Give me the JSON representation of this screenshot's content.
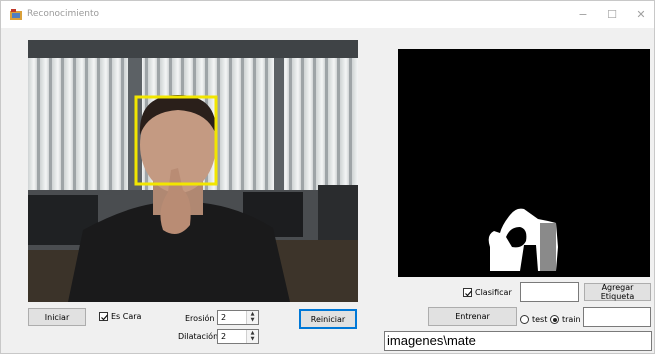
{
  "window": {
    "title": "Reconocimiento"
  },
  "titlebar": {
    "minimize": "−",
    "maximize": "☐",
    "close": "✕"
  },
  "controls": {
    "iniciar_label": "Iniciar",
    "es_cara_label": "Es Cara",
    "es_cara_checked": true,
    "erosion_label": "Erosión",
    "erosion_value": "2",
    "dilatacion_label": "Dilatación",
    "dilatacion_value": "2",
    "reiniciar_label": "Reiniciar"
  },
  "right_panel": {
    "clasificar_label": "Clasificar",
    "clasificar_checked": true,
    "clasificar_value": "",
    "agregar_etiqueta_label": "Agregar Etiqueta",
    "entrenar_label": "Entrenar",
    "test_label": "test",
    "train_label": "train",
    "selected_mode": "train",
    "train_value": "",
    "path_value": "imagenes\\mate"
  },
  "colors": {
    "face_box": "#f2e600",
    "accent_focus": "#0078d7"
  }
}
